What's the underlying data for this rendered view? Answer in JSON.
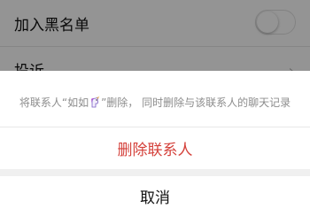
{
  "settings": {
    "blacklist_label": "加入黑名单",
    "complain_label": "投诉",
    "blacklist_toggle_on": false
  },
  "sheet": {
    "message_prefix": "将联系人“如如",
    "message_suffix": "”删除， 同时删除与该联系人的聊天记录",
    "contact_emoji_icon": "unicorn-icon",
    "delete_label": "删除联系人",
    "cancel_label": "取消",
    "delete_color": "#d4403a"
  }
}
